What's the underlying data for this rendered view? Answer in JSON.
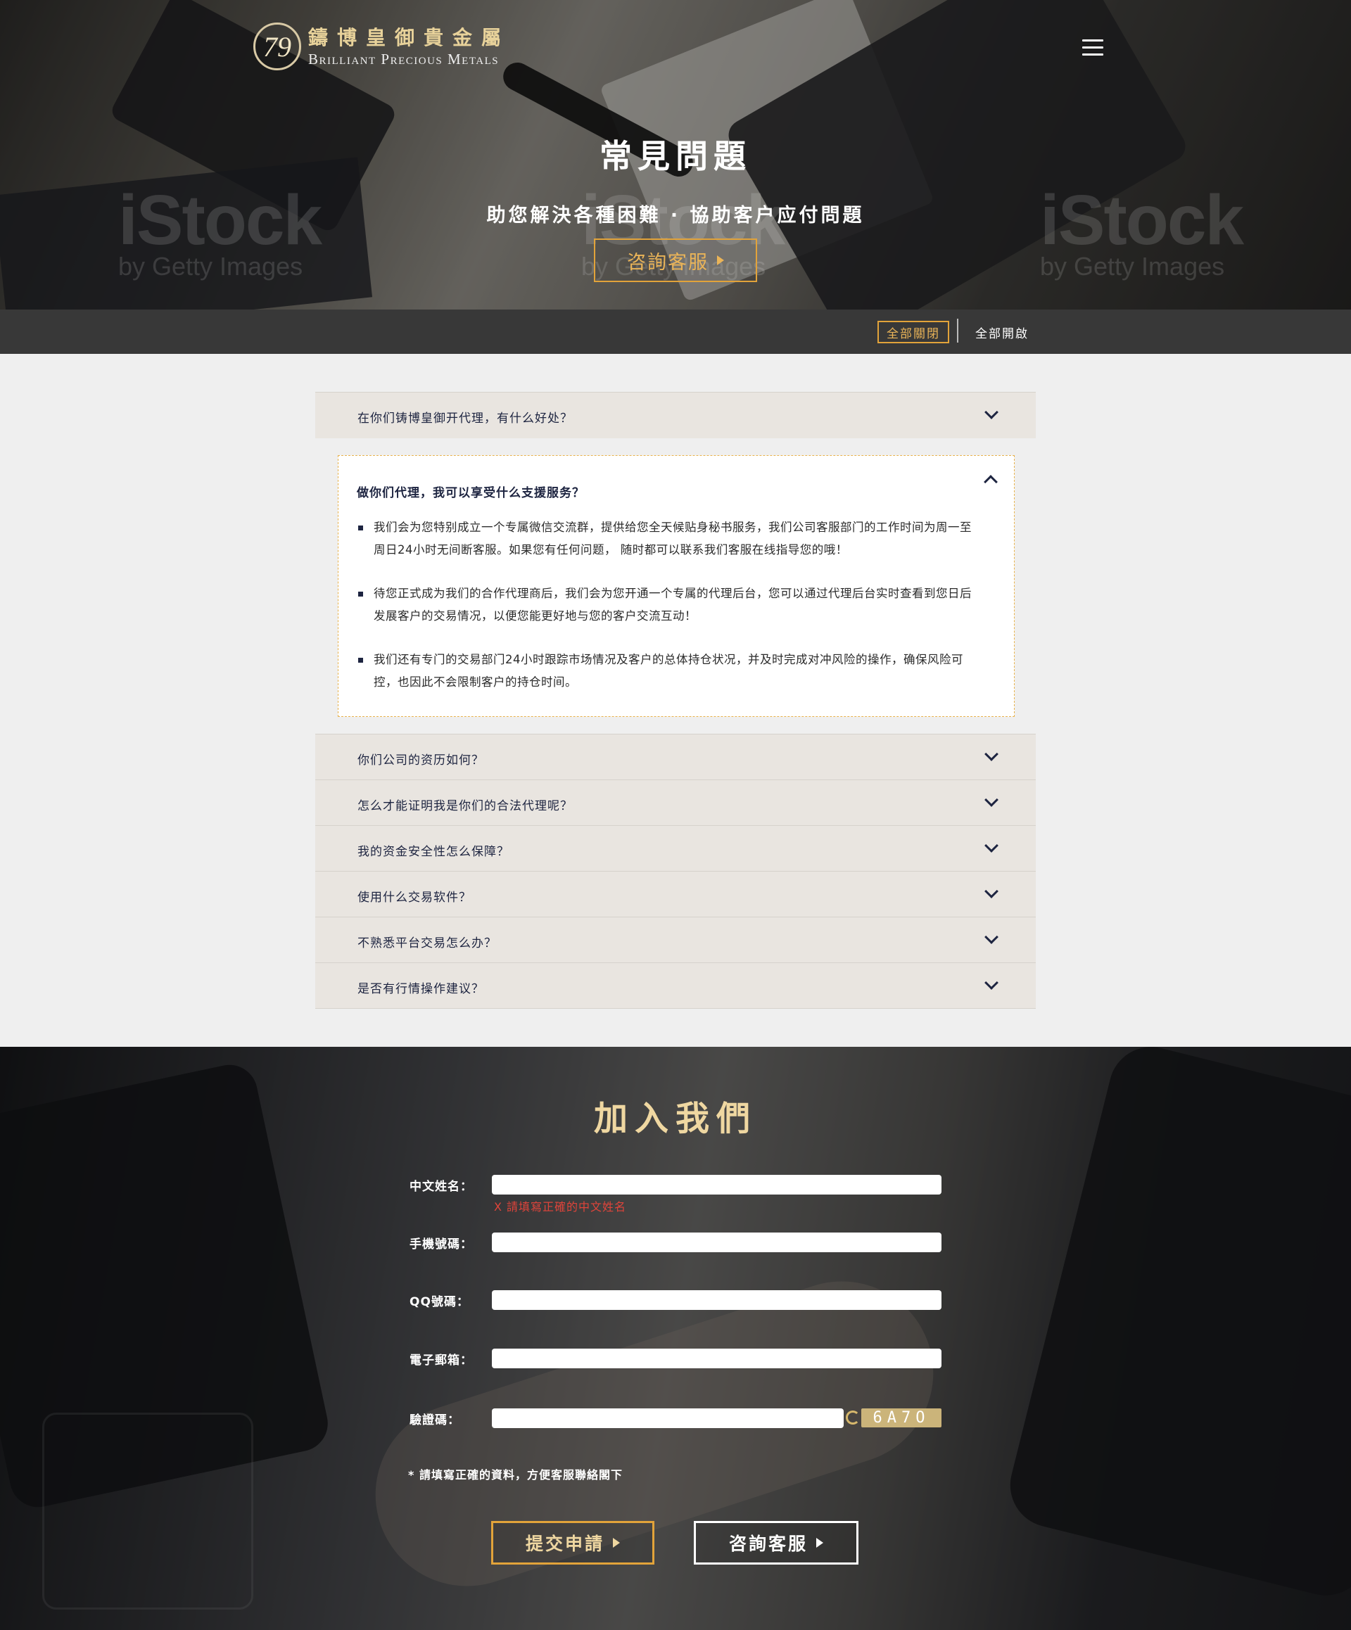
{
  "brand": {
    "logo_number": "79",
    "name_cn": "鑄博皇御貴金屬",
    "name_en": "Brilliant Precious Metals"
  },
  "hero": {
    "title": "常見問題",
    "subtitle": "助您解決各種困難 · 協助客户应付問題",
    "consult_button": "咨詢客服",
    "watermark_big": "iStock",
    "watermark_small": "by Getty Images"
  },
  "toolbar": {
    "collapse_all": "全部關閉",
    "expand_all": "全部開啟"
  },
  "faq": {
    "items": [
      {
        "question": "在你们铸博皇御开代理，有什么好处？"
      },
      {
        "question": "你们公司的资历如何？"
      },
      {
        "question": "怎么才能证明我是你们的合法代理呢？"
      },
      {
        "question": "我的资金安全性怎么保障？"
      },
      {
        "question": "使用什么交易软件？"
      },
      {
        "question": "不熟悉平台交易怎么办？"
      },
      {
        "question": "是否有行情操作建议？"
      }
    ],
    "open_item": {
      "question": "做你们代理，我可以享受什么支援服务？",
      "answers": [
        "我们会为您特别成立一个专属微信交流群，提供给您全天候贴身秘书服务，我们公司客服部门的工作时间为周一至周日24小时无间断客服。如果您有任何问题， 随时都可以联系我们客服在线指导您的哦！",
        "待您正式成为我们的合作代理商后，我们会为您开通一个专属的代理后台，您可以通过代理后台实时查看到您日后发展客户的交易情况，以便您能更好地与您的客户交流互动！",
        "我们还有专门的交易部门24小时跟踪市场情况及客户的总体持仓状况，并及时完成对冲风险的操作，确保风险可控，也因此不会限制客户的持仓时间。"
      ]
    }
  },
  "join": {
    "title": "加入我們",
    "fields": {
      "name_label": "中文姓名：",
      "name_error": "X  請填寫正確的中文姓名",
      "phone_label": "手機號碼：",
      "qq_label": "QQ號碼：",
      "email_label": "電子郵箱：",
      "captcha_label": "驗證碼：",
      "captcha_code": "6A7O"
    },
    "note": "* 請填寫正確的資料，方便客服聯絡閣下",
    "submit_button": "提交申請",
    "consult_button": "咨詢客服"
  },
  "colors": {
    "accent_gold": "#e2a33a",
    "title_gold": "#efd7a1",
    "navy": "#1d2440",
    "error_red": "#e0443a",
    "toolbar_bg": "#383838"
  },
  "icons": [
    "menu-icon",
    "chevron-down-icon",
    "chevron-up-icon",
    "play-arrow-icon",
    "refresh-icon"
  ]
}
